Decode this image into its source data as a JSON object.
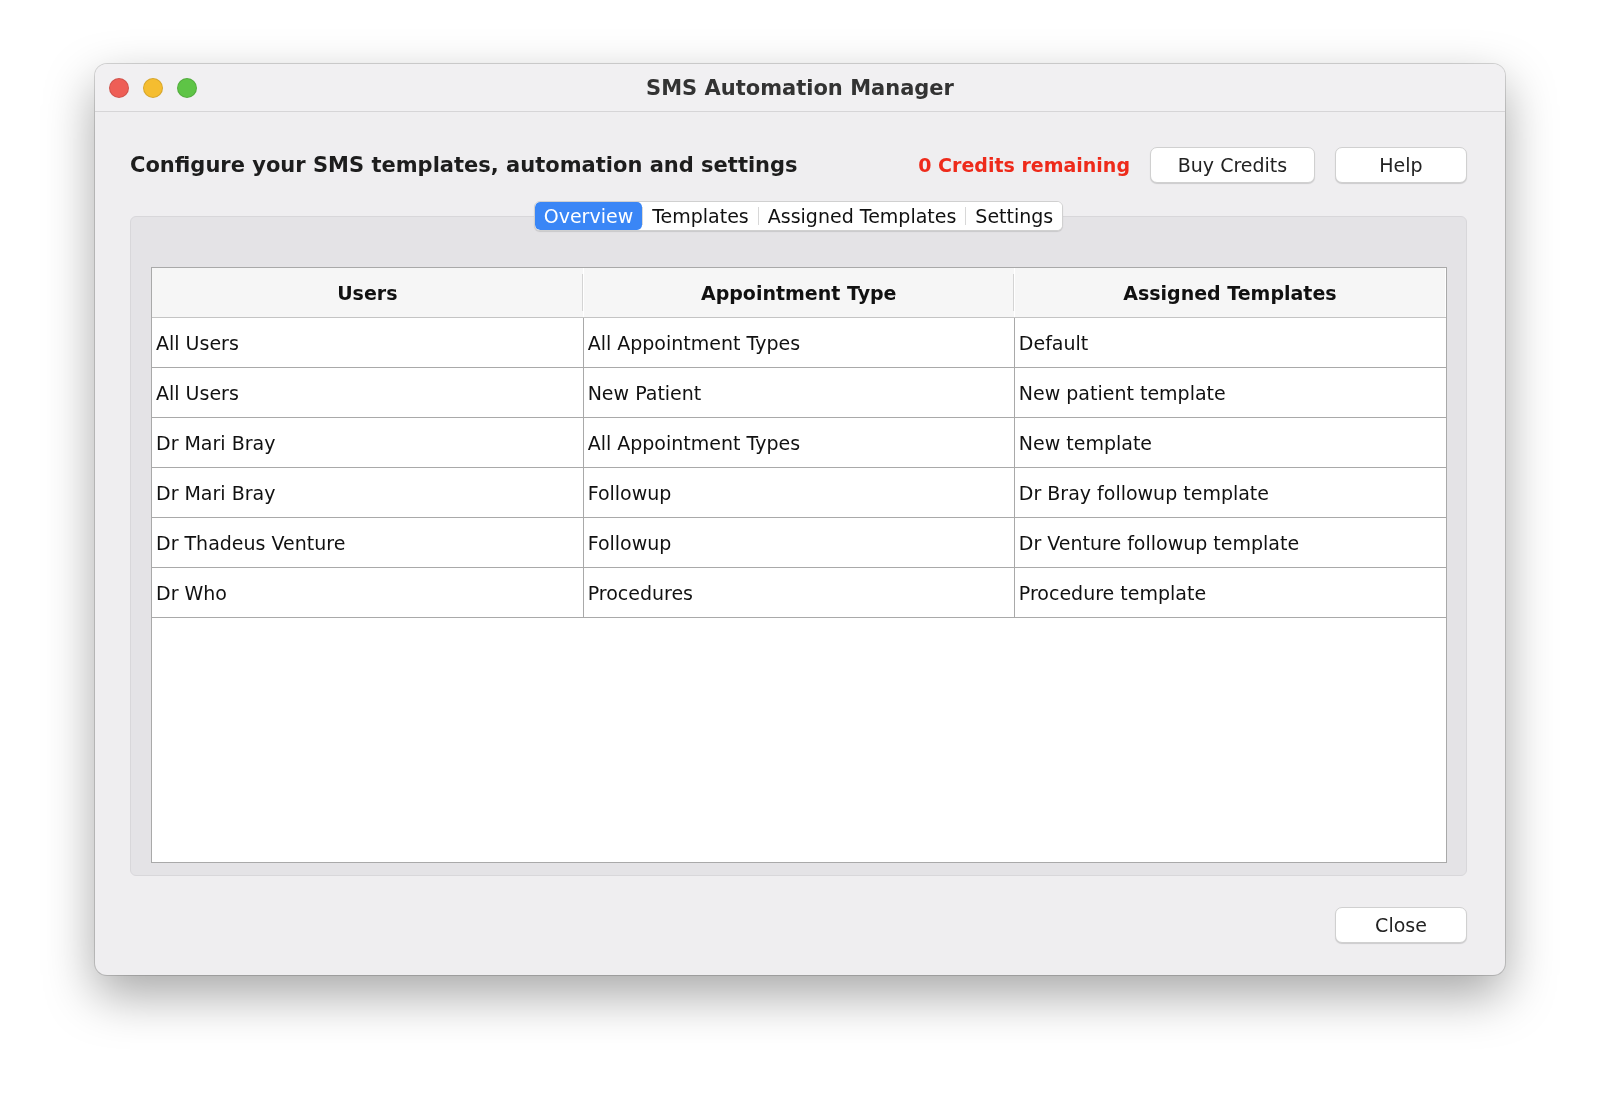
{
  "window": {
    "title": "SMS Automation Manager"
  },
  "header": {
    "heading": "Configure your SMS templates, automation and settings",
    "credits": "0 Credits remaining",
    "buttons": [
      "Buy Credits",
      "Help"
    ]
  },
  "tabs": [
    {
      "label": "Overview",
      "selected": true
    },
    {
      "label": "Templates",
      "selected": false
    },
    {
      "label": "Assigned Templates",
      "selected": false
    },
    {
      "label": "Settings",
      "selected": false
    }
  ],
  "table": {
    "columns": [
      "Users",
      "Appointment Type",
      "Assigned Templates"
    ],
    "rows": [
      [
        "All Users",
        "All Appointment Types",
        "Default"
      ],
      [
        "All Users",
        "New Patient",
        "New patient template"
      ],
      [
        "Dr Mari Bray",
        "All Appointment Types",
        "New template"
      ],
      [
        "Dr Mari Bray",
        "Followup",
        "Dr Bray followup template"
      ],
      [
        "Dr Thadeus Venture",
        "Followup",
        "Dr Venture followup template"
      ],
      [
        "Dr Who",
        "Procedures",
        "Procedure template"
      ]
    ]
  },
  "footer_buttons": [
    "Close"
  ]
}
